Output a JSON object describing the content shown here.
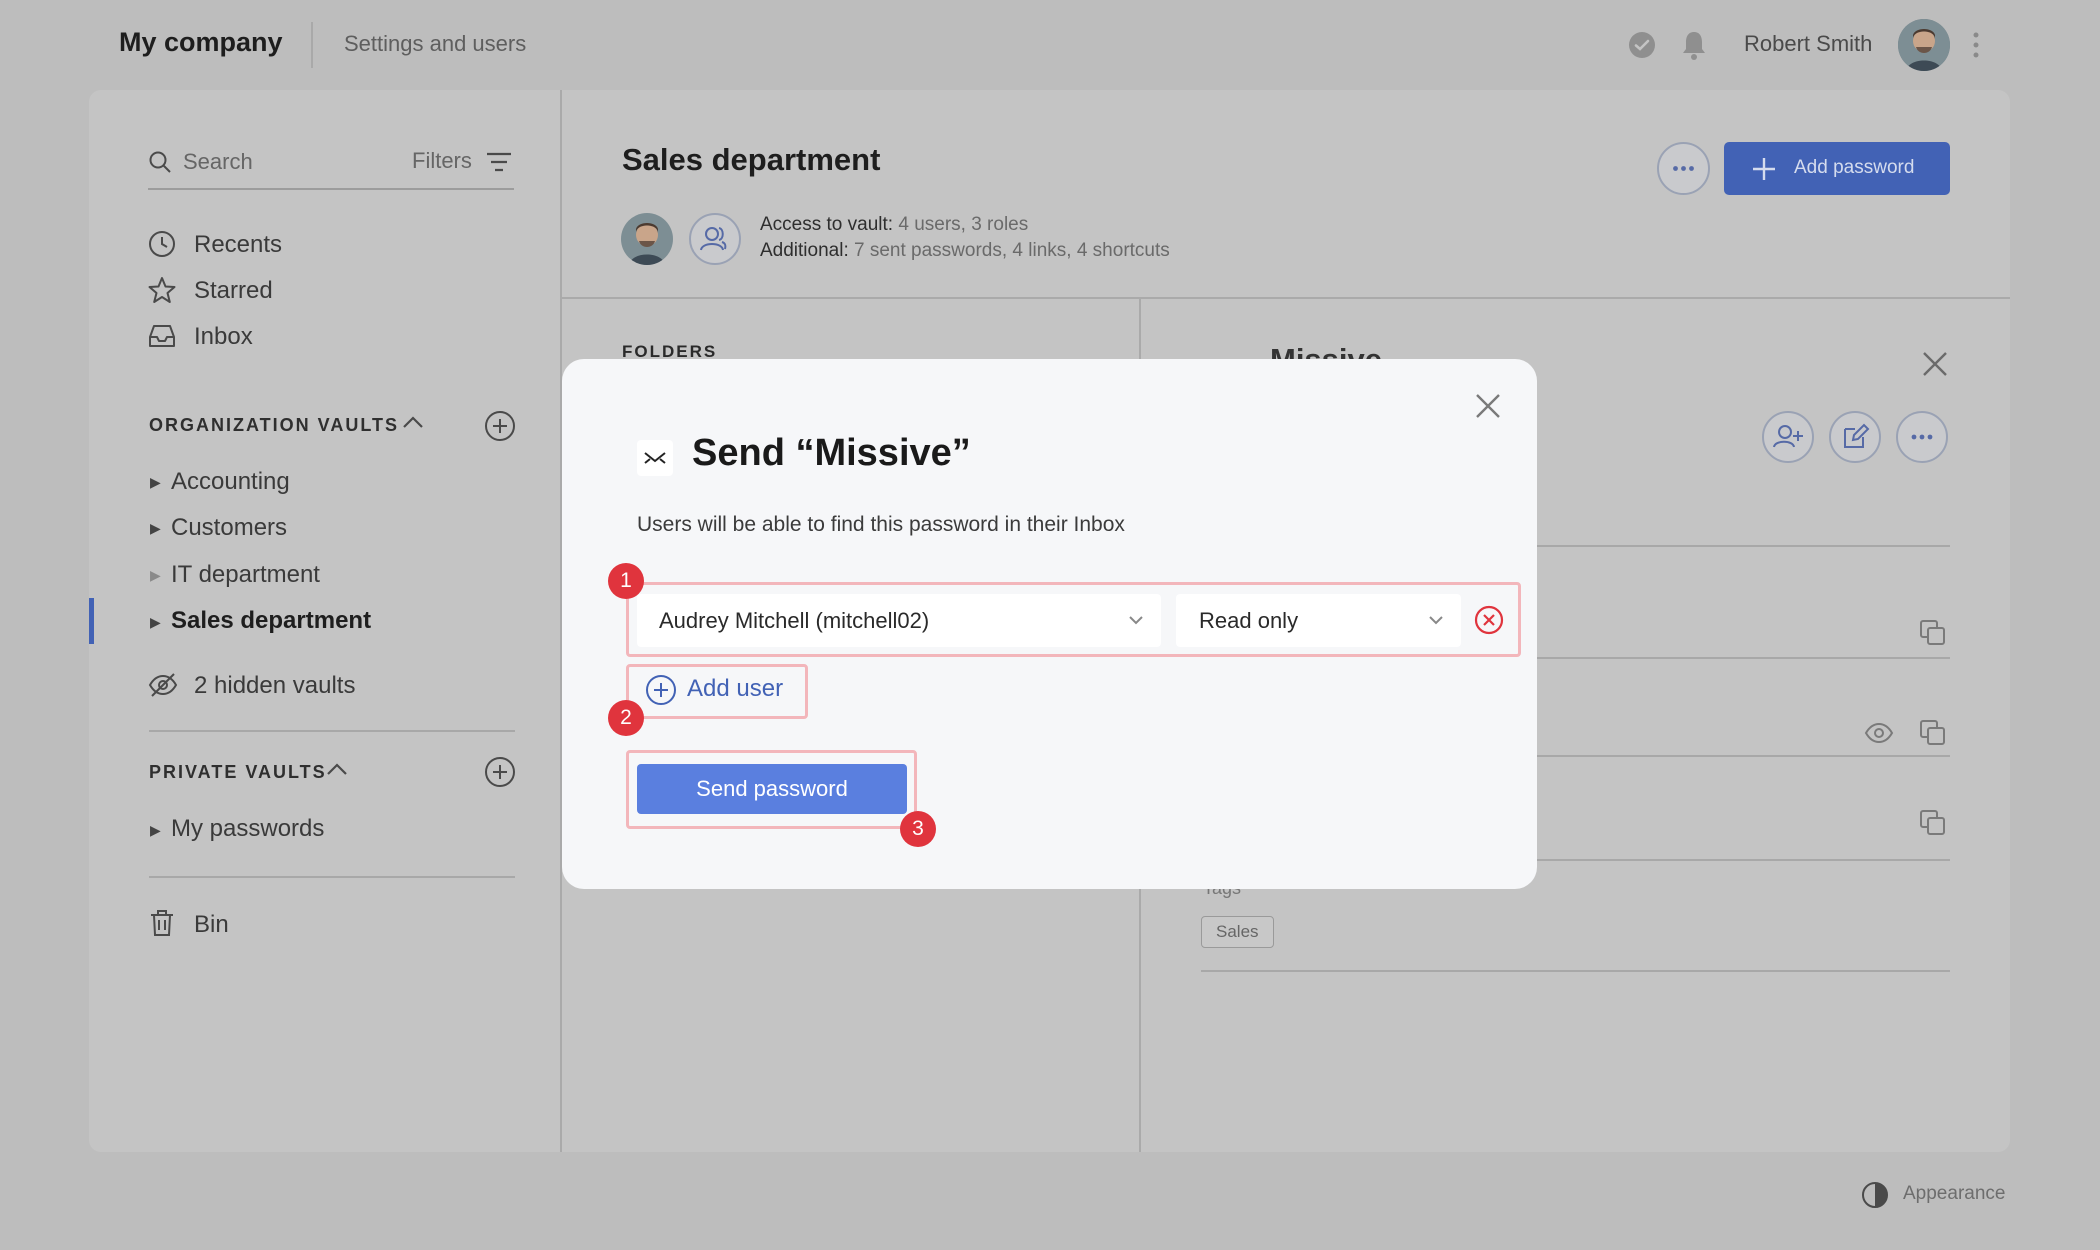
{
  "topbar": {
    "company": "My company",
    "settings_link": "Settings and users",
    "user_name": "Robert Smith"
  },
  "sidebar": {
    "search_placeholder": "Search",
    "filters_label": "Filters",
    "nav": [
      {
        "label": "Recents",
        "icon": "clock-icon"
      },
      {
        "label": "Starred",
        "icon": "star-icon"
      },
      {
        "label": "Inbox",
        "icon": "inbox-icon"
      }
    ],
    "org_vaults_title": "ORGANIZATION VAULTS",
    "org_vaults": [
      {
        "label": "Accounting"
      },
      {
        "label": "Customers"
      },
      {
        "label": "IT department"
      },
      {
        "label": "Sales department"
      }
    ],
    "hidden_vaults": "2 hidden vaults",
    "private_vaults_title": "PRIVATE VAULTS",
    "private_vaults": [
      {
        "label": "My passwords"
      }
    ],
    "bin": "Bin"
  },
  "main": {
    "vault_title": "Sales department",
    "access_label": "Access to vault:",
    "access_value": "4 users, 3 roles",
    "additional_label": "Additional:",
    "additional_value": "7 sent passwords, 4 links, 4 shortcuts",
    "add_password": "Add password",
    "folders_label": "FOLDERS"
  },
  "detail": {
    "title": "Missive",
    "tags_label": "Tags",
    "tag": "Sales"
  },
  "modal": {
    "title": "Send “Missive”",
    "description": "Users will be able to find this password in their Inbox",
    "user_select": "Audrey Mitchell (mitchell02)",
    "permission_select": "Read only",
    "add_user": "Add user",
    "send_button": "Send password",
    "badges": [
      "1",
      "2",
      "3"
    ]
  },
  "footer": {
    "appearance": "Appearance"
  },
  "colors": {
    "accent": "#4262b5",
    "send_button": "#5a7fdf",
    "badge": "#e0343d",
    "highlight": "#f3b6bb"
  }
}
